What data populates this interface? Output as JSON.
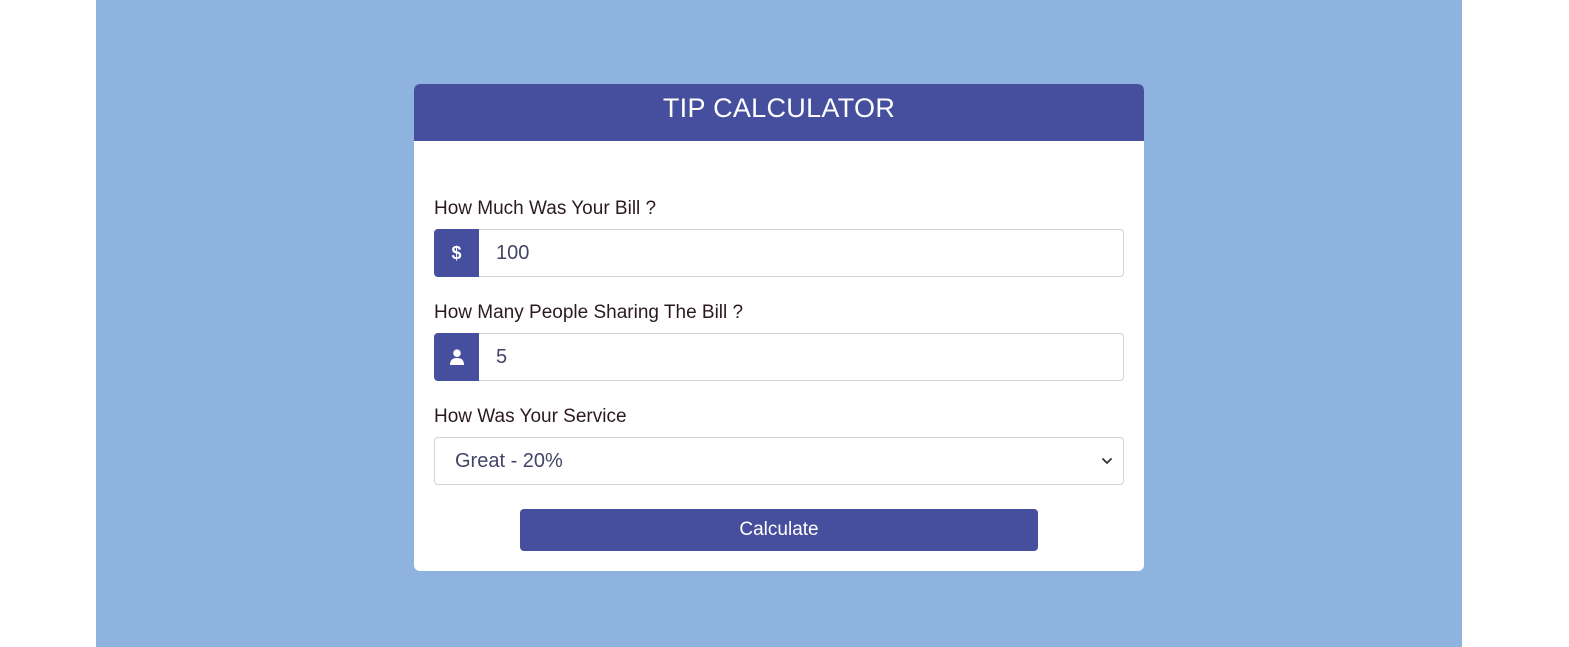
{
  "app": {
    "title": "TIP CALCULATOR"
  },
  "bill": {
    "label": "How Much Was Your Bill ?",
    "icon": "dollar-icon",
    "icon_glyph": "$",
    "value": "100"
  },
  "people": {
    "label": "How Many People Sharing The Bill ?",
    "icon": "user-icon",
    "value": "5"
  },
  "service": {
    "label": "How Was Your Service",
    "selected": "Great - 20%",
    "icon": "chevron-down-icon"
  },
  "actions": {
    "calculate_label": "Calculate"
  },
  "colors": {
    "page_background": "#8eb3de",
    "accent": "#454f9e",
    "card": "#ffffff",
    "label_text": "#2b1a22"
  }
}
